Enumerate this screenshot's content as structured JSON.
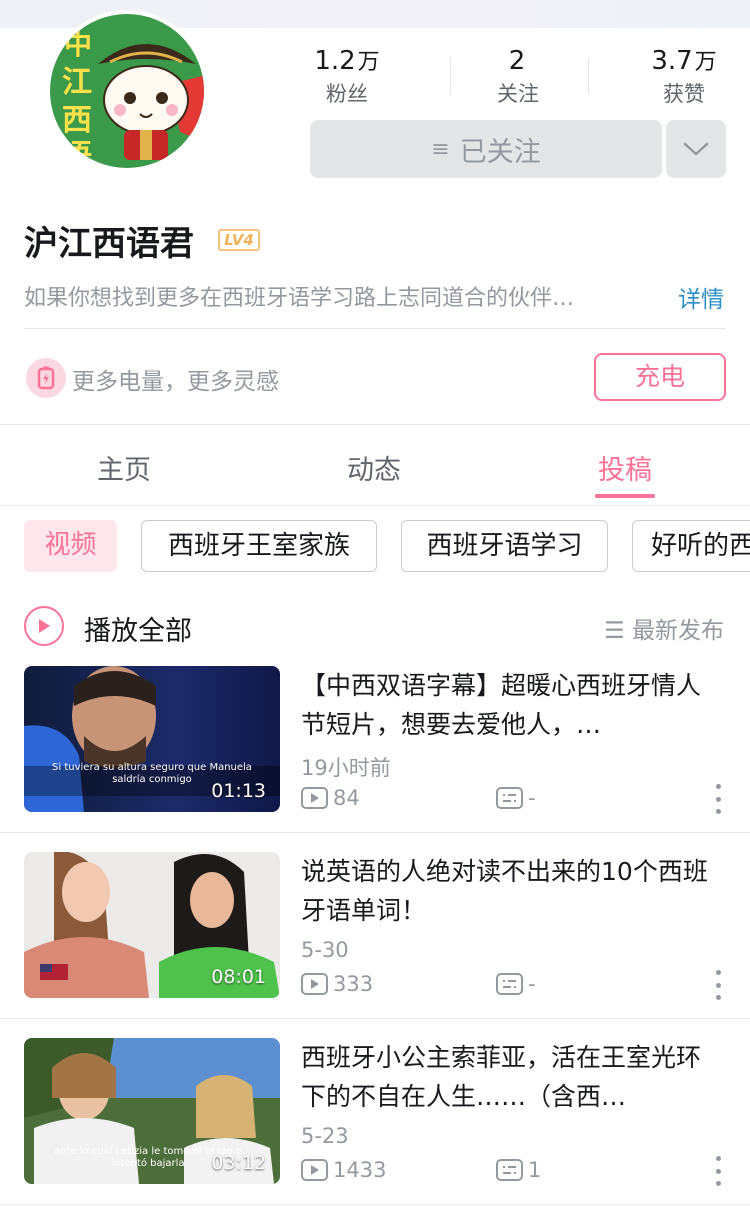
{
  "profile": {
    "name": "沪江西语君",
    "level": "LV4",
    "bio": "如果你想找到更多在西班牙语学习路上志同道合的伙伴…",
    "detail_link": "详情"
  },
  "stats": [
    {
      "value": "1.2",
      "unit": "万",
      "label": "粉丝"
    },
    {
      "value": "2",
      "unit": "",
      "label": "关注"
    },
    {
      "value": "3.7",
      "unit": "万",
      "label": "获赞"
    }
  ],
  "follow_button": {
    "glyph": "≡",
    "label": "已关注"
  },
  "charge": {
    "text": "更多电量，更多灵感",
    "button": "充电"
  },
  "tabs": [
    {
      "label": "主页",
      "active": false
    },
    {
      "label": "动态",
      "active": false
    },
    {
      "label": "投稿",
      "active": true
    }
  ],
  "filters": [
    "视频",
    "西班牙王室家族",
    "西班牙语学习",
    "好听的西"
  ],
  "play_all": {
    "label": "播放全部",
    "sort": "最新发布",
    "sort_glyph": "☰"
  },
  "videos": [
    {
      "title": "【中西双语字幕】超暖心西班牙情人节短片，想要去爱他人，…",
      "date": "19小时前",
      "plays": "84",
      "danmaku": "-",
      "duration": "01:13",
      "subtitle": "Si tuviera su altura seguro que Manuela saldría conmigo"
    },
    {
      "title": "说英语的人绝对读不出来的10个西班牙语单词！",
      "date": "5-30",
      "plays": "333",
      "danmaku": "-",
      "duration": "08:01",
      "subtitle": ""
    },
    {
      "title": "西班牙小公主索菲亚，活在王室光环下的不自在人生……（含西…",
      "date": "5-23",
      "plays": "1433",
      "danmaku": "1",
      "duration": "03:12",
      "subtitle": "ante lo cual Letizia le tomó el brazo e intentó bajarla"
    }
  ],
  "colors": {
    "accent": "#fb7299",
    "link": "#2c8fc9",
    "muted": "#9499a0"
  }
}
